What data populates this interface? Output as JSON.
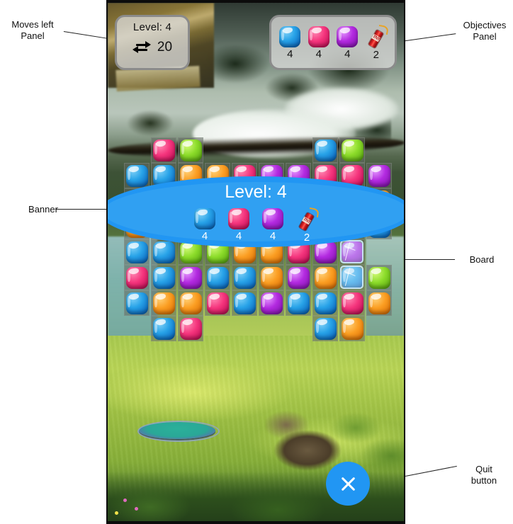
{
  "annotations": [
    {
      "id": "moves-left-panel",
      "label": "Moves left\nPanel"
    },
    {
      "id": "objectives-panel",
      "label": "Objectives\nPanel"
    },
    {
      "id": "banner",
      "label": "Banner"
    },
    {
      "id": "board",
      "label": "Board"
    },
    {
      "id": "quit-button",
      "label": "Quit\nbutton"
    }
  ],
  "hud": {
    "moves_panel": {
      "level_label": "Level: 4",
      "moves_icon": "swap-arrows-icon",
      "moves_left": "20"
    },
    "objectives_panel": {
      "items": [
        {
          "icon": "blue-candy-icon",
          "color": "#28a3e8",
          "count": "4"
        },
        {
          "icon": "pink-candy-icon",
          "color": "#f5357d",
          "count": "4"
        },
        {
          "icon": "purple-candy-icon",
          "color": "#b32ae0",
          "count": "4"
        },
        {
          "icon": "tnt-icon",
          "color": "#e02327",
          "count": "2"
        }
      ]
    }
  },
  "banner": {
    "title": "Level:  4",
    "objectives": [
      {
        "icon": "blue-candy-icon",
        "color": "#28a3e8",
        "count": "4"
      },
      {
        "icon": "pink-candy-icon",
        "color": "#f5357d",
        "count": "4"
      },
      {
        "icon": "purple-candy-icon",
        "color": "#b32ae0",
        "count": "4"
      },
      {
        "icon": "tnt-icon",
        "color": "#e02327",
        "count": "2"
      }
    ]
  },
  "quit_button": {
    "icon": "close-x-icon",
    "color": "#2196f3"
  },
  "board": {
    "columns": 10,
    "rows": 9,
    "palette": {
      "blue": "#28a3e8",
      "pink": "#f5357d",
      "purple": "#b32ae0",
      "green": "#8cdc2a",
      "orange": "#fb9e22"
    },
    "grid": [
      [
        "",
        "pink",
        "green",
        "",
        "",
        "",
        "",
        "blue",
        "green",
        ""
      ],
      [
        "blue",
        "blue",
        "orange",
        "orange",
        "pink",
        "purple",
        "purple",
        "pink",
        "pink",
        "purple"
      ],
      [
        "purple",
        "blue",
        "blue",
        "purple",
        "purple",
        "green",
        "pink",
        "orange",
        "pink",
        "orange"
      ],
      [
        "orange",
        "purple",
        "pink",
        "green",
        "green",
        "blue",
        "purple",
        "orange",
        "green",
        "blue"
      ],
      [
        "blue",
        "blue",
        "green",
        "green",
        "orange",
        "orange",
        "pink",
        "purple",
        "",
        ""
      ],
      [
        "pink",
        "blue",
        "purple",
        "blue",
        "blue",
        "orange",
        "purple",
        "orange",
        "blue",
        "green"
      ],
      [
        "blue",
        "orange",
        "orange",
        "pink",
        "blue",
        "purple",
        "blue",
        "blue",
        "pink",
        "orange"
      ],
      [
        "",
        "blue",
        "pink",
        "",
        "",
        "",
        "",
        "blue",
        "orange",
        ""
      ]
    ],
    "ice_cells": [
      {
        "row": 4,
        "col": 8,
        "candy": "purple"
      },
      {
        "row": 5,
        "col": 8,
        "candy": "blue"
      }
    ]
  }
}
